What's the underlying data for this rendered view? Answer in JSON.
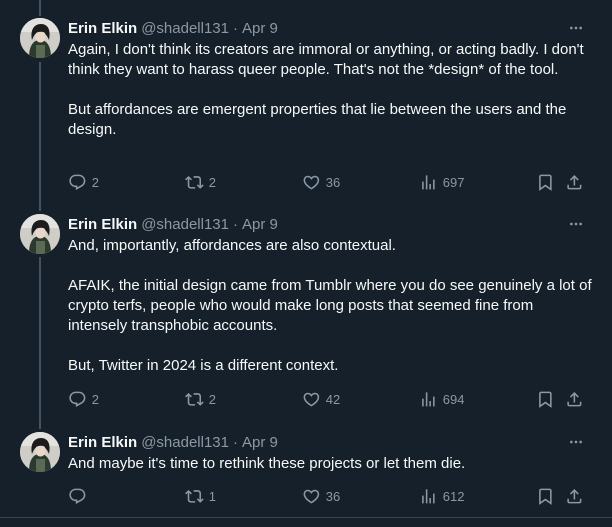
{
  "theme": {
    "background": "#15202b",
    "text": "#f7f9f9",
    "secondary": "#8b98a5",
    "divider": "#38444d",
    "thread_line": "#425364"
  },
  "icons": {
    "reply": "speech-bubble-icon",
    "repost": "repost-arrows-icon",
    "like": "heart-icon",
    "views": "bar-chart-icon",
    "bookmark": "bookmark-icon",
    "share": "share-upload-icon",
    "more": "ellipsis-icon"
  },
  "tweets": [
    {
      "author": {
        "display_name": "Erin Elkin",
        "handle": "@shadell131"
      },
      "separator": "·",
      "date": "Apr 9",
      "paragraphs": [
        "Again, I don't think its creators are immoral or anything, or acting badly. I don't think they want to harass queer people. That's not the *design* of the tool.",
        "But affordances are emergent properties that lie between the users and the design."
      ],
      "metrics": {
        "replies": "2",
        "reposts": "2",
        "likes": "36",
        "views": "697"
      }
    },
    {
      "author": {
        "display_name": "Erin Elkin",
        "handle": "@shadell131"
      },
      "separator": "·",
      "date": "Apr 9",
      "paragraphs": [
        "And, importantly, affordances are also contextual.",
        "AFAIK, the initial design came from Tumblr where you do see genuinely a lot of crypto terfs, people who would make long posts that seemed fine from intensely transphobic accounts.",
        "But, Twitter in 2024 is a different context."
      ],
      "metrics": {
        "replies": "2",
        "reposts": "2",
        "likes": "42",
        "views": "694"
      }
    },
    {
      "author": {
        "display_name": "Erin Elkin",
        "handle": "@shadell131"
      },
      "separator": "·",
      "date": "Apr 9",
      "paragraphs": [
        "And maybe it's time to rethink these projects or let them die."
      ],
      "metrics": {
        "replies": "",
        "reposts": "1",
        "likes": "36",
        "views": "612"
      }
    }
  ]
}
